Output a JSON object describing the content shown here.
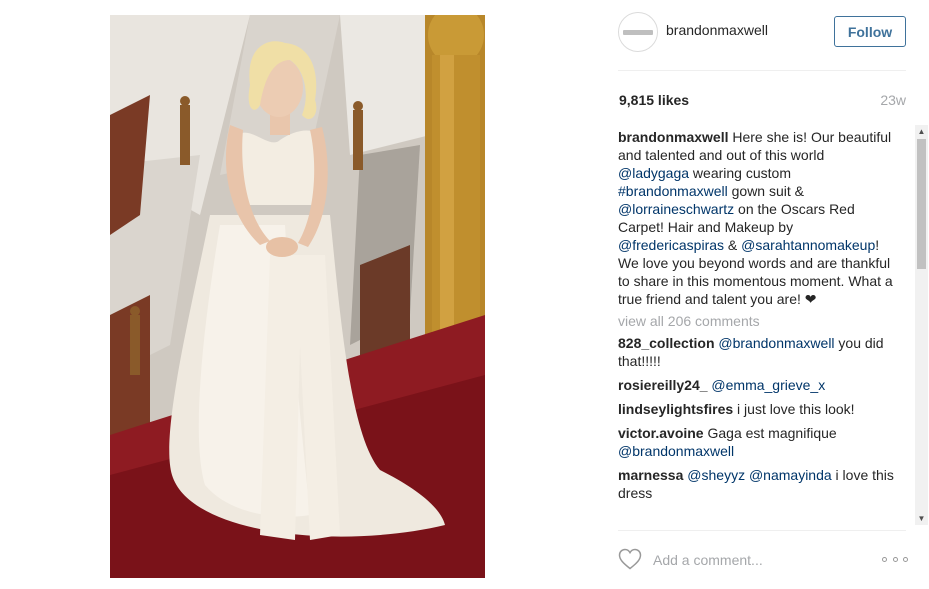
{
  "post": {
    "username": "brandonmaxwell",
    "follow_label": "Follow",
    "likes": "9,815 likes",
    "time": "23w",
    "caption": {
      "user": "brandonmaxwell",
      "t1": " Here she is! Our beautiful and talented and out of this world ",
      "m1": "@ladygaga",
      "t2": " wearing custom ",
      "m2": "#brandonmaxwell",
      "t3": " gown suit & ",
      "m3": "@lorraineschwartz",
      "t4": " on the Oscars Red Carpet! Hair and Makeup by ",
      "m4": "@fredericaspiras",
      "t5": " & ",
      "m5": "@sarahtannomakeup",
      "t6": "! We love you beyond words and are thankful to share in this momentous moment. What a true friend and talent you are! ❤"
    },
    "view_all": "view all 206 comments",
    "comments": [
      {
        "user": "828_collection",
        "mention1": "@brandonmaxwell",
        "text": " you did that!!!!!"
      },
      {
        "user": "rosiereilly24_",
        "mention1": "@emma_grieve_x"
      },
      {
        "user": "lindseylightsfires",
        "text": " i just love this look!"
      },
      {
        "user": "victor.avoine",
        "text": " Gaga est magnifique ",
        "mention1": "@brandonmaxwell"
      },
      {
        "user": "marnessa",
        "mention1": "@sheyyz",
        "mention2": "@namayinda",
        "text": " i love this dress"
      }
    ],
    "comment_placeholder": "Add a comment...",
    "icons": {
      "like": "heart-icon",
      "more": "more-options-icon",
      "scroll_up": "scroll-up-icon",
      "scroll_down": "scroll-down-icon"
    }
  },
  "colors": {
    "link": "#003569",
    "follow": "#3f729b",
    "muted": "#a5a7aa",
    "text": "#262626"
  }
}
